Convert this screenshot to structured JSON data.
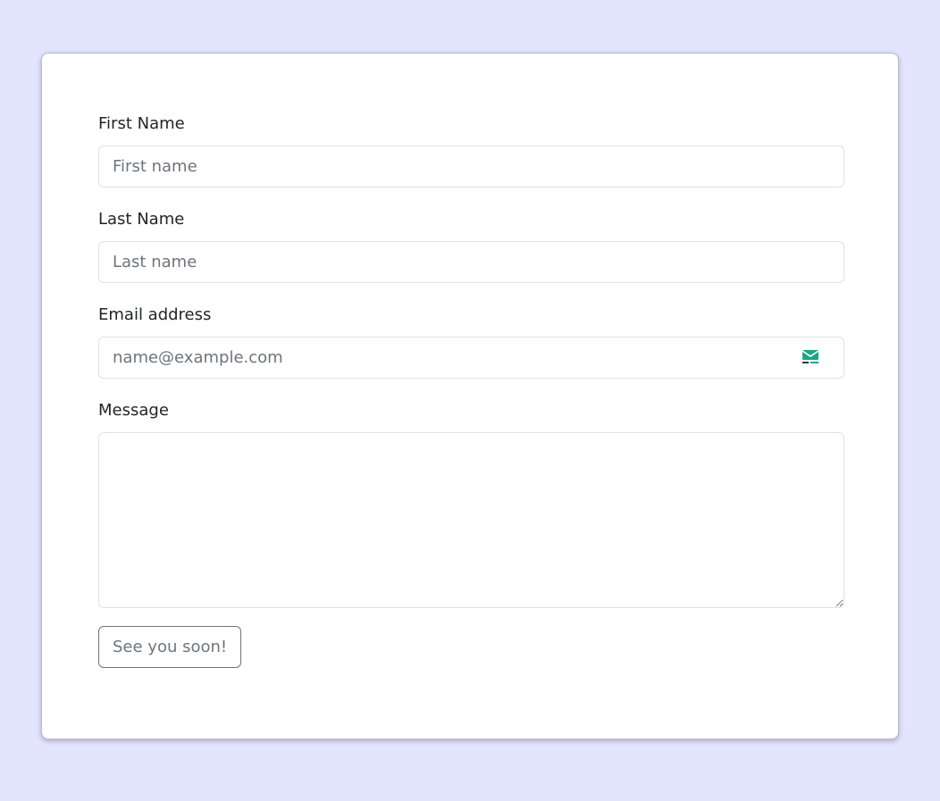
{
  "form": {
    "first_name": {
      "label": "First Name",
      "placeholder": "First name",
      "value": ""
    },
    "last_name": {
      "label": "Last Name",
      "placeholder": "Last name",
      "value": ""
    },
    "email": {
      "label": "Email address",
      "placeholder": "name@example.com",
      "value": "",
      "icon": "mail-icon"
    },
    "message": {
      "label": "Message",
      "value": ""
    },
    "submit_label": "See you soon!"
  },
  "colors": {
    "page_background": "#e3e5ff",
    "card_background": "#ffffff",
    "mail_icon": "#1aa784",
    "button_outline": "#6c757d"
  }
}
